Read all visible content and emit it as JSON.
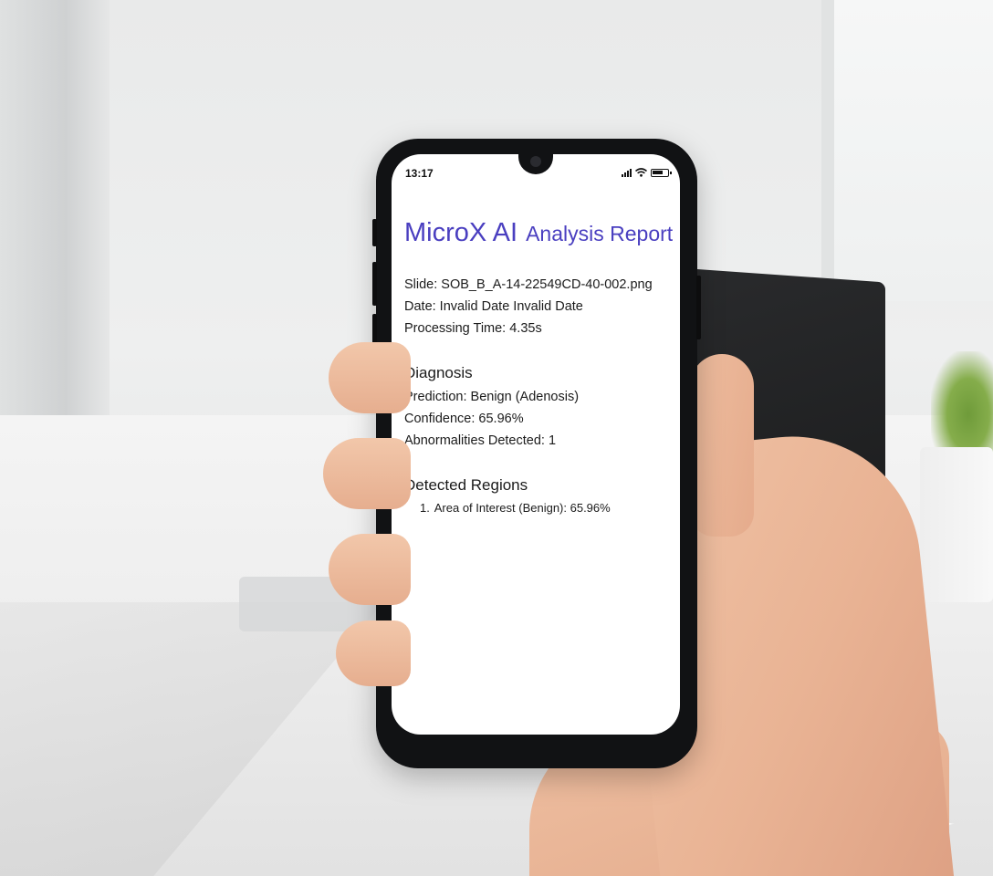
{
  "status_bar": {
    "time": "13:17",
    "icons": [
      "signal-icon",
      "wifi-icon",
      "battery-icon"
    ]
  },
  "report": {
    "title_brand": "MicroX AI",
    "title_sub": "Analysis Report",
    "title_color": "#4a3fc0",
    "slide_line": "Slide: SOB_B_A-14-22549CD-40-002.png",
    "date_line": "Date: Invalid Date Invalid Date",
    "processing_line": "Processing Time: 4.35s",
    "diagnosis": {
      "heading": "Diagnosis",
      "prediction_line": "Prediction: Benign (Adenosis)",
      "confidence_line": "Confidence: 65.96%",
      "abnormalities_line": "Abnormalities Detected: 1"
    },
    "regions": {
      "heading": "Detected Regions",
      "items": [
        {
          "number": "1.",
          "text": "Area of Interest (Benign): 65.96%"
        }
      ]
    }
  }
}
